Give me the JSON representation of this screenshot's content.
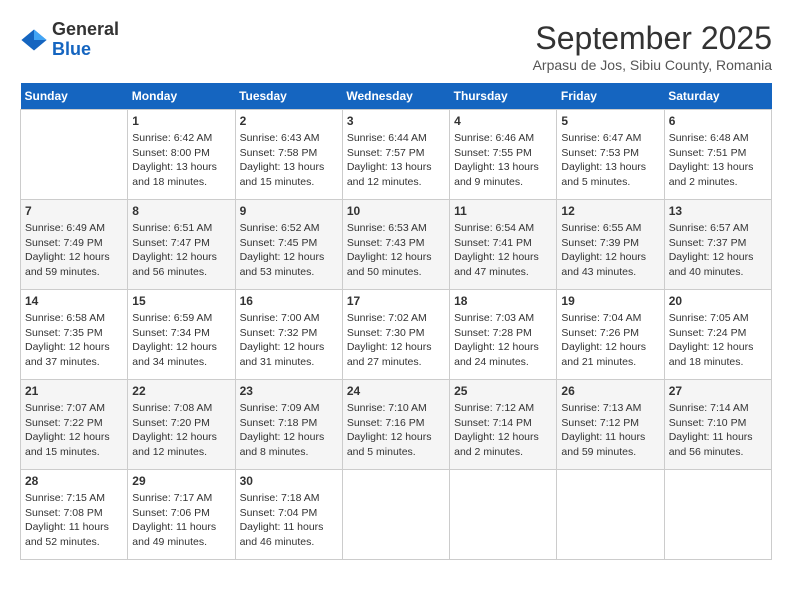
{
  "header": {
    "logo_line1": "General",
    "logo_line2": "Blue",
    "month_title": "September 2025",
    "subtitle": "Arpasu de Jos, Sibiu County, Romania"
  },
  "weekdays": [
    "Sunday",
    "Monday",
    "Tuesday",
    "Wednesday",
    "Thursday",
    "Friday",
    "Saturday"
  ],
  "weeks": [
    [
      {
        "day": "",
        "info": ""
      },
      {
        "day": "1",
        "info": "Sunrise: 6:42 AM\nSunset: 8:00 PM\nDaylight: 13 hours\nand 18 minutes."
      },
      {
        "day": "2",
        "info": "Sunrise: 6:43 AM\nSunset: 7:58 PM\nDaylight: 13 hours\nand 15 minutes."
      },
      {
        "day": "3",
        "info": "Sunrise: 6:44 AM\nSunset: 7:57 PM\nDaylight: 13 hours\nand 12 minutes."
      },
      {
        "day": "4",
        "info": "Sunrise: 6:46 AM\nSunset: 7:55 PM\nDaylight: 13 hours\nand 9 minutes."
      },
      {
        "day": "5",
        "info": "Sunrise: 6:47 AM\nSunset: 7:53 PM\nDaylight: 13 hours\nand 5 minutes."
      },
      {
        "day": "6",
        "info": "Sunrise: 6:48 AM\nSunset: 7:51 PM\nDaylight: 13 hours\nand 2 minutes."
      }
    ],
    [
      {
        "day": "7",
        "info": "Sunrise: 6:49 AM\nSunset: 7:49 PM\nDaylight: 12 hours\nand 59 minutes."
      },
      {
        "day": "8",
        "info": "Sunrise: 6:51 AM\nSunset: 7:47 PM\nDaylight: 12 hours\nand 56 minutes."
      },
      {
        "day": "9",
        "info": "Sunrise: 6:52 AM\nSunset: 7:45 PM\nDaylight: 12 hours\nand 53 minutes."
      },
      {
        "day": "10",
        "info": "Sunrise: 6:53 AM\nSunset: 7:43 PM\nDaylight: 12 hours\nand 50 minutes."
      },
      {
        "day": "11",
        "info": "Sunrise: 6:54 AM\nSunset: 7:41 PM\nDaylight: 12 hours\nand 47 minutes."
      },
      {
        "day": "12",
        "info": "Sunrise: 6:55 AM\nSunset: 7:39 PM\nDaylight: 12 hours\nand 43 minutes."
      },
      {
        "day": "13",
        "info": "Sunrise: 6:57 AM\nSunset: 7:37 PM\nDaylight: 12 hours\nand 40 minutes."
      }
    ],
    [
      {
        "day": "14",
        "info": "Sunrise: 6:58 AM\nSunset: 7:35 PM\nDaylight: 12 hours\nand 37 minutes."
      },
      {
        "day": "15",
        "info": "Sunrise: 6:59 AM\nSunset: 7:34 PM\nDaylight: 12 hours\nand 34 minutes."
      },
      {
        "day": "16",
        "info": "Sunrise: 7:00 AM\nSunset: 7:32 PM\nDaylight: 12 hours\nand 31 minutes."
      },
      {
        "day": "17",
        "info": "Sunrise: 7:02 AM\nSunset: 7:30 PM\nDaylight: 12 hours\nand 27 minutes."
      },
      {
        "day": "18",
        "info": "Sunrise: 7:03 AM\nSunset: 7:28 PM\nDaylight: 12 hours\nand 24 minutes."
      },
      {
        "day": "19",
        "info": "Sunrise: 7:04 AM\nSunset: 7:26 PM\nDaylight: 12 hours\nand 21 minutes."
      },
      {
        "day": "20",
        "info": "Sunrise: 7:05 AM\nSunset: 7:24 PM\nDaylight: 12 hours\nand 18 minutes."
      }
    ],
    [
      {
        "day": "21",
        "info": "Sunrise: 7:07 AM\nSunset: 7:22 PM\nDaylight: 12 hours\nand 15 minutes."
      },
      {
        "day": "22",
        "info": "Sunrise: 7:08 AM\nSunset: 7:20 PM\nDaylight: 12 hours\nand 12 minutes."
      },
      {
        "day": "23",
        "info": "Sunrise: 7:09 AM\nSunset: 7:18 PM\nDaylight: 12 hours\nand 8 minutes."
      },
      {
        "day": "24",
        "info": "Sunrise: 7:10 AM\nSunset: 7:16 PM\nDaylight: 12 hours\nand 5 minutes."
      },
      {
        "day": "25",
        "info": "Sunrise: 7:12 AM\nSunset: 7:14 PM\nDaylight: 12 hours\nand 2 minutes."
      },
      {
        "day": "26",
        "info": "Sunrise: 7:13 AM\nSunset: 7:12 PM\nDaylight: 11 hours\nand 59 minutes."
      },
      {
        "day": "27",
        "info": "Sunrise: 7:14 AM\nSunset: 7:10 PM\nDaylight: 11 hours\nand 56 minutes."
      }
    ],
    [
      {
        "day": "28",
        "info": "Sunrise: 7:15 AM\nSunset: 7:08 PM\nDaylight: 11 hours\nand 52 minutes."
      },
      {
        "day": "29",
        "info": "Sunrise: 7:17 AM\nSunset: 7:06 PM\nDaylight: 11 hours\nand 49 minutes."
      },
      {
        "day": "30",
        "info": "Sunrise: 7:18 AM\nSunset: 7:04 PM\nDaylight: 11 hours\nand 46 minutes."
      },
      {
        "day": "",
        "info": ""
      },
      {
        "day": "",
        "info": ""
      },
      {
        "day": "",
        "info": ""
      },
      {
        "day": "",
        "info": ""
      }
    ]
  ]
}
